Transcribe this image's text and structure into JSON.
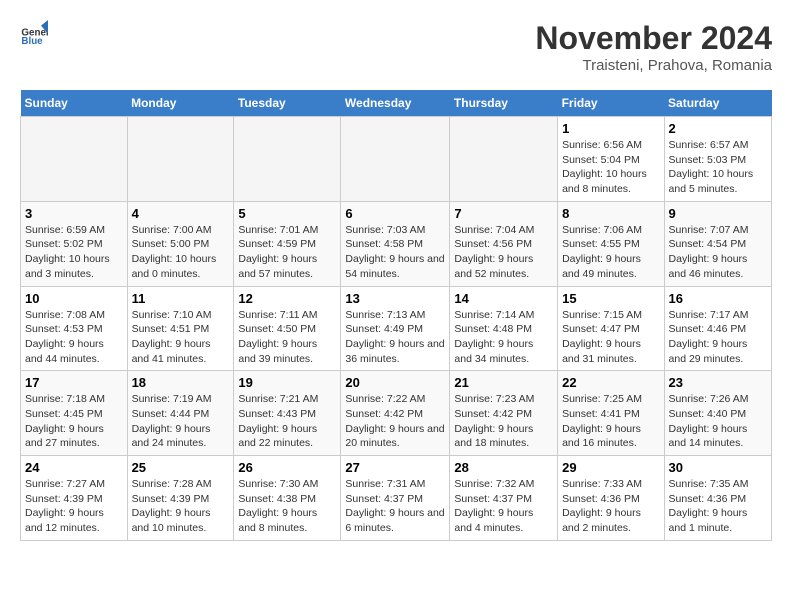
{
  "header": {
    "logo_general": "General",
    "logo_blue": "Blue",
    "month_title": "November 2024",
    "subtitle": "Traisteni, Prahova, Romania"
  },
  "days_of_week": [
    "Sunday",
    "Monday",
    "Tuesday",
    "Wednesday",
    "Thursday",
    "Friday",
    "Saturday"
  ],
  "weeks": [
    [
      {
        "day": "",
        "info": ""
      },
      {
        "day": "",
        "info": ""
      },
      {
        "day": "",
        "info": ""
      },
      {
        "day": "",
        "info": ""
      },
      {
        "day": "",
        "info": ""
      },
      {
        "day": "1",
        "info": "Sunrise: 6:56 AM\nSunset: 5:04 PM\nDaylight: 10 hours and 8 minutes."
      },
      {
        "day": "2",
        "info": "Sunrise: 6:57 AM\nSunset: 5:03 PM\nDaylight: 10 hours and 5 minutes."
      }
    ],
    [
      {
        "day": "3",
        "info": "Sunrise: 6:59 AM\nSunset: 5:02 PM\nDaylight: 10 hours and 3 minutes."
      },
      {
        "day": "4",
        "info": "Sunrise: 7:00 AM\nSunset: 5:00 PM\nDaylight: 10 hours and 0 minutes."
      },
      {
        "day": "5",
        "info": "Sunrise: 7:01 AM\nSunset: 4:59 PM\nDaylight: 9 hours and 57 minutes."
      },
      {
        "day": "6",
        "info": "Sunrise: 7:03 AM\nSunset: 4:58 PM\nDaylight: 9 hours and 54 minutes."
      },
      {
        "day": "7",
        "info": "Sunrise: 7:04 AM\nSunset: 4:56 PM\nDaylight: 9 hours and 52 minutes."
      },
      {
        "day": "8",
        "info": "Sunrise: 7:06 AM\nSunset: 4:55 PM\nDaylight: 9 hours and 49 minutes."
      },
      {
        "day": "9",
        "info": "Sunrise: 7:07 AM\nSunset: 4:54 PM\nDaylight: 9 hours and 46 minutes."
      }
    ],
    [
      {
        "day": "10",
        "info": "Sunrise: 7:08 AM\nSunset: 4:53 PM\nDaylight: 9 hours and 44 minutes."
      },
      {
        "day": "11",
        "info": "Sunrise: 7:10 AM\nSunset: 4:51 PM\nDaylight: 9 hours and 41 minutes."
      },
      {
        "day": "12",
        "info": "Sunrise: 7:11 AM\nSunset: 4:50 PM\nDaylight: 9 hours and 39 minutes."
      },
      {
        "day": "13",
        "info": "Sunrise: 7:13 AM\nSunset: 4:49 PM\nDaylight: 9 hours and 36 minutes."
      },
      {
        "day": "14",
        "info": "Sunrise: 7:14 AM\nSunset: 4:48 PM\nDaylight: 9 hours and 34 minutes."
      },
      {
        "day": "15",
        "info": "Sunrise: 7:15 AM\nSunset: 4:47 PM\nDaylight: 9 hours and 31 minutes."
      },
      {
        "day": "16",
        "info": "Sunrise: 7:17 AM\nSunset: 4:46 PM\nDaylight: 9 hours and 29 minutes."
      }
    ],
    [
      {
        "day": "17",
        "info": "Sunrise: 7:18 AM\nSunset: 4:45 PM\nDaylight: 9 hours and 27 minutes."
      },
      {
        "day": "18",
        "info": "Sunrise: 7:19 AM\nSunset: 4:44 PM\nDaylight: 9 hours and 24 minutes."
      },
      {
        "day": "19",
        "info": "Sunrise: 7:21 AM\nSunset: 4:43 PM\nDaylight: 9 hours and 22 minutes."
      },
      {
        "day": "20",
        "info": "Sunrise: 7:22 AM\nSunset: 4:42 PM\nDaylight: 9 hours and 20 minutes."
      },
      {
        "day": "21",
        "info": "Sunrise: 7:23 AM\nSunset: 4:42 PM\nDaylight: 9 hours and 18 minutes."
      },
      {
        "day": "22",
        "info": "Sunrise: 7:25 AM\nSunset: 4:41 PM\nDaylight: 9 hours and 16 minutes."
      },
      {
        "day": "23",
        "info": "Sunrise: 7:26 AM\nSunset: 4:40 PM\nDaylight: 9 hours and 14 minutes."
      }
    ],
    [
      {
        "day": "24",
        "info": "Sunrise: 7:27 AM\nSunset: 4:39 PM\nDaylight: 9 hours and 12 minutes."
      },
      {
        "day": "25",
        "info": "Sunrise: 7:28 AM\nSunset: 4:39 PM\nDaylight: 9 hours and 10 minutes."
      },
      {
        "day": "26",
        "info": "Sunrise: 7:30 AM\nSunset: 4:38 PM\nDaylight: 9 hours and 8 minutes."
      },
      {
        "day": "27",
        "info": "Sunrise: 7:31 AM\nSunset: 4:37 PM\nDaylight: 9 hours and 6 minutes."
      },
      {
        "day": "28",
        "info": "Sunrise: 7:32 AM\nSunset: 4:37 PM\nDaylight: 9 hours and 4 minutes."
      },
      {
        "day": "29",
        "info": "Sunrise: 7:33 AM\nSunset: 4:36 PM\nDaylight: 9 hours and 2 minutes."
      },
      {
        "day": "30",
        "info": "Sunrise: 7:35 AM\nSunset: 4:36 PM\nDaylight: 9 hours and 1 minute."
      }
    ]
  ]
}
